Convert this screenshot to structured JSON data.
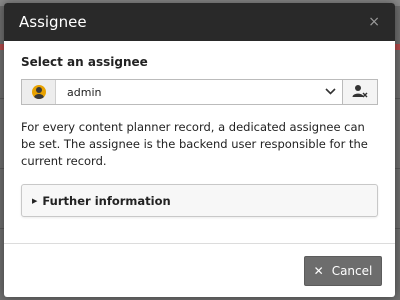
{
  "modal": {
    "title": "Assignee",
    "close_glyph": "×"
  },
  "assignee": {
    "section_label": "Select an assignee",
    "selected_value": "admin",
    "chevron_glyph": "⌄",
    "avatar_color": "#e8a200",
    "action_icon": "user-remove-icon"
  },
  "description": "For every content planner record, a dedicated assignee can be set. The assignee is the backend user responsible for the current record.",
  "panel": {
    "caret": "▶",
    "title": "Further information"
  },
  "footer": {
    "cancel_icon": "✕",
    "cancel_label": "Cancel",
    "cancel_color": "#6d6d6d"
  },
  "colors": {
    "header_bg": "#292929",
    "overlay": "#6f6f6f"
  }
}
